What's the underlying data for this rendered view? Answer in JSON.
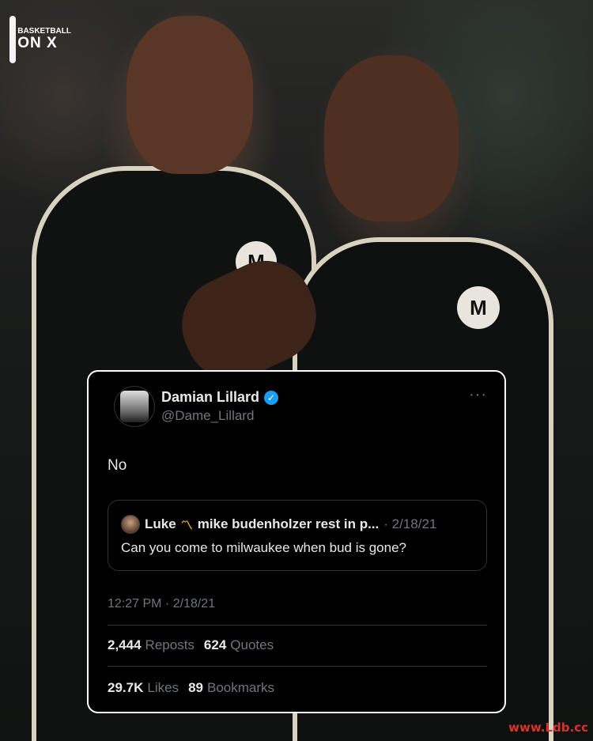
{
  "brand": {
    "line1": "BASKETBALL",
    "line2": "ON X"
  },
  "watermark": "www.Ldb.cc",
  "jersey_logo": "M",
  "tweet": {
    "display_name": "Damian Lillard",
    "handle": "@Dame_Lillard",
    "verified_glyph": "✓",
    "more_glyph": "···",
    "text": "No",
    "quoted": {
      "name": "Luke",
      "crown": "〽",
      "name_suffix": "mike budenholzer rest in p...",
      "date": "· 2/18/21",
      "text": "Can you come to milwaukee when bud is gone?"
    },
    "timestamp": "12:27 PM · 2/18/21",
    "stats": {
      "reposts_count": "2,444",
      "reposts_label": "Reposts",
      "quotes_count": "624",
      "quotes_label": "Quotes",
      "likes_count": "29.7K",
      "likes_label": "Likes",
      "bookmarks_count": "89",
      "bookmarks_label": "Bookmarks"
    }
  }
}
